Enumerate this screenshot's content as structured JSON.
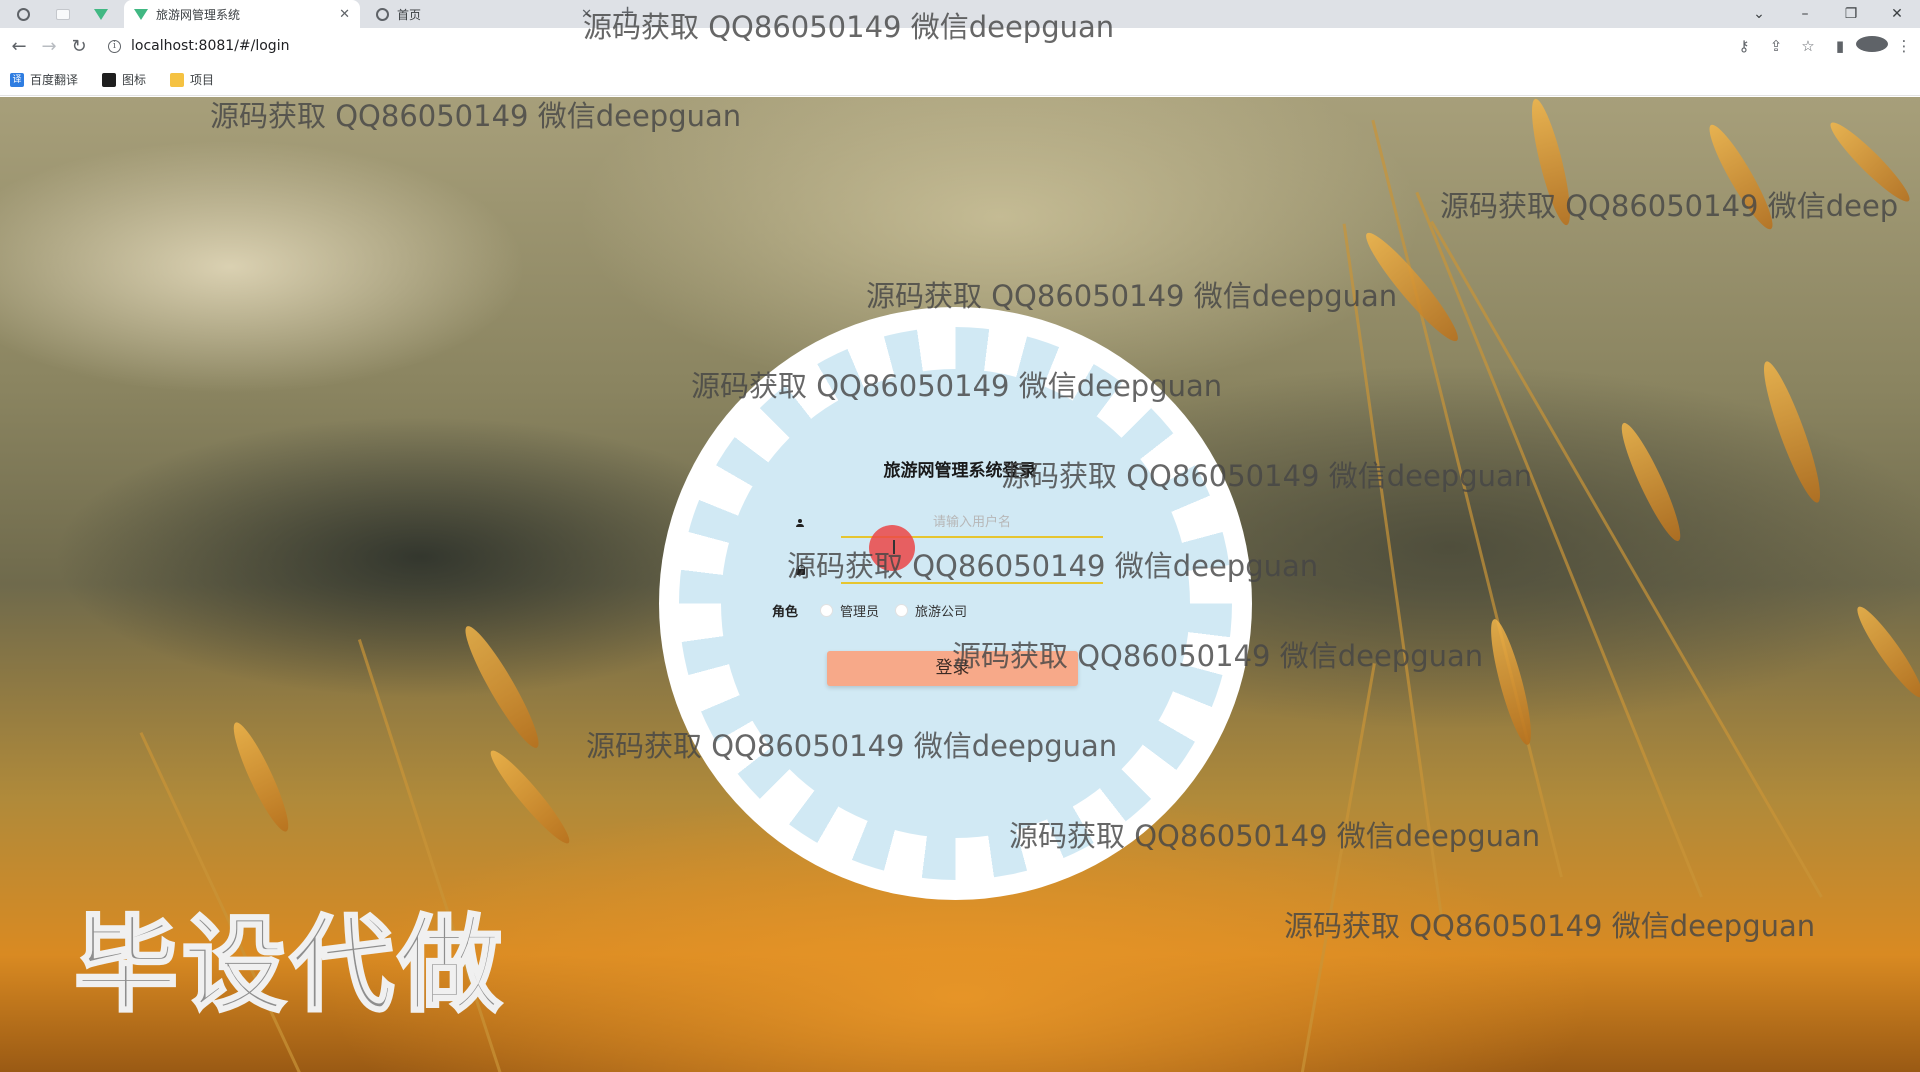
{
  "browser": {
    "tabs": [
      {
        "title": "旅游网管理系统",
        "active": true
      },
      {
        "title": "首页",
        "active": false
      }
    ],
    "url": "localhost:8081/#/login",
    "bookmarks": [
      "百度翻译",
      "图标",
      "项目"
    ]
  },
  "login": {
    "title": "旅游网管理系统登录",
    "username_placeholder": "请输入用户名",
    "role_label": "角色",
    "roles": [
      "管理员",
      "旅游公司"
    ],
    "submit_label": "登录"
  },
  "watermark": {
    "text": "源码获取 QQ86050149 微信deepguan",
    "text_cut": "源码获取 QQ86050149 微信deep",
    "big_text": "毕设代做"
  },
  "colors": {
    "disc_blue": "#d1e9f4",
    "underline": "#e6c530",
    "button": "#f7a989"
  }
}
